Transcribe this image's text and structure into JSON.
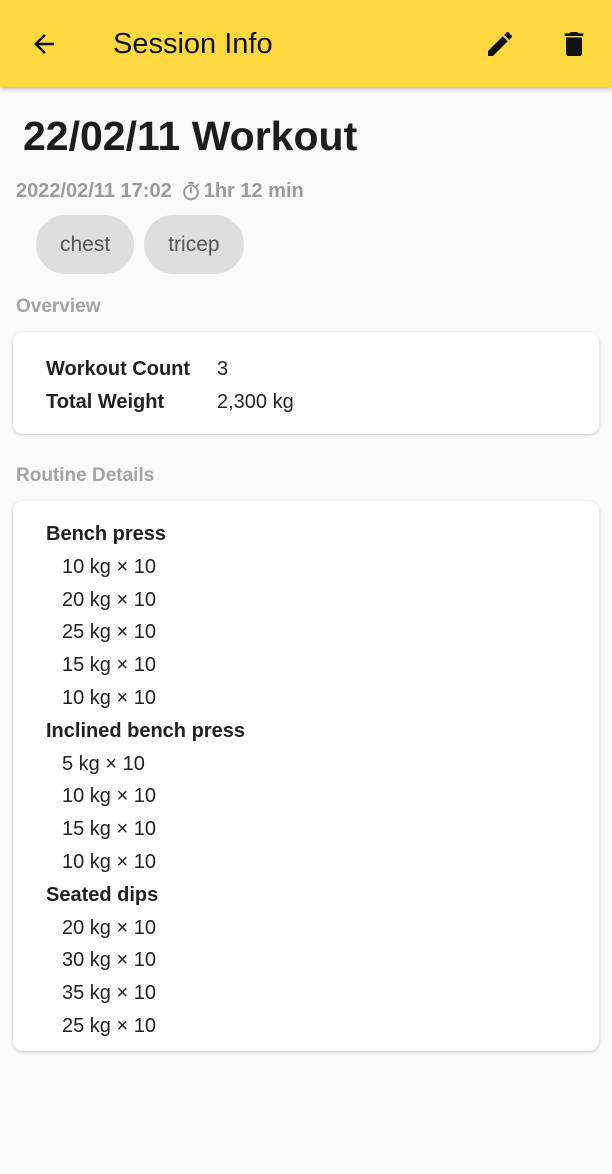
{
  "appbar": {
    "title": "Session Info",
    "back_icon": "arrow-back-icon",
    "edit_icon": "pencil-icon",
    "delete_icon": "trash-icon"
  },
  "session": {
    "title": "22/02/11 Workout",
    "datetime": "2022/02/11 17:02",
    "duration": "1hr 12 min",
    "tags": [
      "chest",
      "tricep"
    ]
  },
  "overview": {
    "label": "Overview",
    "rows": [
      {
        "key": "Workout Count",
        "value": "3"
      },
      {
        "key": "Total Weight",
        "value": "2,300 kg"
      }
    ]
  },
  "routine": {
    "label": "Routine Details",
    "exercises": [
      {
        "name": "Bench press",
        "sets": [
          "10 kg × 10",
          "20 kg × 10",
          "25 kg × 10",
          "15 kg × 10",
          "10 kg × 10"
        ]
      },
      {
        "name": "Inclined bench press",
        "sets": [
          "5 kg × 10",
          "10 kg × 10",
          "15 kg × 10",
          "10 kg × 10"
        ]
      },
      {
        "name": "Seated dips",
        "sets": [
          "20 kg × 10",
          "30 kg × 10",
          "35 kg × 10",
          "25 kg × 10"
        ]
      }
    ]
  },
  "colors": {
    "appbar": "#fdd83f",
    "chip_bg": "#dedede",
    "muted_text": "#9a9a9a"
  }
}
